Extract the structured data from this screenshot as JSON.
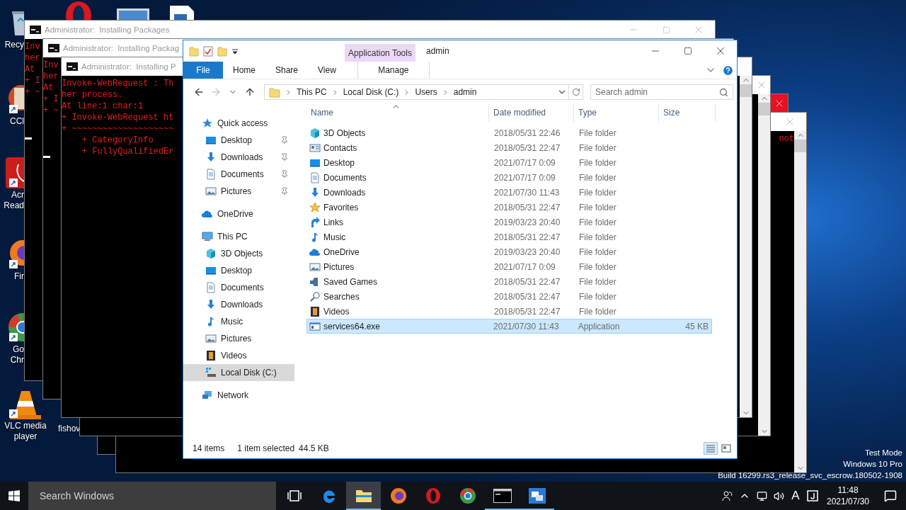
{
  "desktop": {
    "icons": [
      {
        "kind": "recycle",
        "lines": [
          "Recy"
        ],
        "shortcut": false
      },
      {
        "kind": "opera"
      },
      {
        "kind": "monitor"
      },
      {
        "kind": "document"
      },
      {
        "kind": "ccleaner",
        "lines": [
          "CCl"
        ],
        "shortcut": true
      },
      {
        "kind": "acrobat",
        "lines": [
          "Acr",
          "Read"
        ],
        "shortcut": true
      },
      {
        "kind": "firefox",
        "lines": [
          "Fir"
        ],
        "shortcut": true
      },
      {
        "kind": "chrome",
        "lines": [
          "Go",
          "Chr"
        ],
        "shortcut": true
      },
      {
        "kind": "vlc",
        "lines": [
          "VLC media",
          "player"
        ],
        "shortcut": true
      },
      {
        "kind": "file",
        "lines": [
          "fishov"
        ]
      }
    ],
    "system_text": [
      "Test Mode",
      "Windows 10 Pro",
      "Build 16299.rs3_release_svc_escrow.180502-1908"
    ]
  },
  "consoles": [
    {
      "title": "Administrator:  Installing Packages",
      "lines": [
        "Inv",
        "her",
        "At",
        "+ I",
        "+ ~"
      ],
      "cursor": true,
      "close_highlighted": false
    },
    {
      "title": "Administrator:  Installing Packag",
      "lines": [
        "Inv",
        "her",
        "At",
        "+ I",
        "+ ~"
      ],
      "cursor": true
    },
    {
      "title": "Administrator:  Installing P",
      "lines": [
        "Invoke-WebRequest : Th",
        "her process.",
        "At line:1 char:1",
        "+ Invoke-WebRequest ht",
        "+ ~~~~~~~~~~~~~~~~~~~~",
        "    + CategoryInfo",
        "    + FullyQualifiedEr"
      ],
      "cursor": false
    },
    {
      "close_highlighted": false
    },
    {
      "close_highlighted": true
    },
    {
      "lines": [
        "not"
      ],
      "close_highlighted": false
    }
  ],
  "explorer": {
    "title": "admin",
    "tool_group": "Application Tools",
    "ribbon_tabs": [
      {
        "label": "File",
        "kind": "file"
      },
      {
        "label": "Home",
        "kind": "tab"
      },
      {
        "label": "Share",
        "kind": "tab"
      },
      {
        "label": "View",
        "kind": "tab"
      },
      {
        "label": "Manage",
        "kind": "contextual"
      }
    ],
    "address": [
      "This PC",
      "Local Disk (C:)",
      "Users",
      "admin"
    ],
    "search": {
      "placeholder": "Search admin"
    },
    "nav": [
      {
        "label": "Quick access",
        "kind": "star",
        "selected": false,
        "children": [
          {
            "label": "Desktop",
            "kind": "desktop",
            "pinned": true,
            "selected": false
          },
          {
            "label": "Downloads",
            "kind": "downloads",
            "pinned": true,
            "selected": false
          },
          {
            "label": "Documents",
            "kind": "documents",
            "pinned": true,
            "selected": false
          },
          {
            "label": "Pictures",
            "kind": "pictures",
            "pinned": true,
            "selected": false
          }
        ]
      },
      {
        "label": "OneDrive",
        "kind": "onedrive",
        "selected": false
      },
      {
        "label": "This PC",
        "kind": "pc",
        "selected": false,
        "children": [
          {
            "label": "3D Objects",
            "kind": "cube",
            "pinned": false,
            "selected": false
          },
          {
            "label": "Desktop",
            "kind": "desktop",
            "pinned": false,
            "selected": false
          },
          {
            "label": "Documents",
            "kind": "documents",
            "pinned": false,
            "selected": false
          },
          {
            "label": "Downloads",
            "kind": "downloads",
            "pinned": false,
            "selected": false
          },
          {
            "label": "Music",
            "kind": "music",
            "pinned": false,
            "selected": false
          },
          {
            "label": "Pictures",
            "kind": "pictures",
            "pinned": false,
            "selected": false
          },
          {
            "label": "Videos",
            "kind": "videos",
            "pinned": false,
            "selected": false
          },
          {
            "label": "Local Disk (C:)",
            "kind": "disk",
            "pinned": false,
            "selected": true
          }
        ]
      },
      {
        "label": "Network",
        "kind": "network",
        "selected": false
      }
    ],
    "columns": [
      {
        "label": "Name",
        "sorted": true
      },
      {
        "label": "Date modified",
        "sorted": false
      },
      {
        "label": "Type",
        "sorted": false
      },
      {
        "label": "Size",
        "sorted": false
      }
    ],
    "rows": [
      {
        "name": "3D Objects",
        "kind": "cube",
        "date": "2018/05/31 22:46",
        "type": "File folder",
        "selected": false
      },
      {
        "name": "Contacts",
        "kind": "contacts",
        "date": "2018/05/31 22:47",
        "type": "File folder",
        "selected": false
      },
      {
        "name": "Desktop",
        "kind": "desktop",
        "date": "2021/07/17 0:09",
        "type": "File folder",
        "selected": false
      },
      {
        "name": "Documents",
        "kind": "documents",
        "date": "2021/07/17 0:09",
        "type": "File folder",
        "selected": false
      },
      {
        "name": "Downloads",
        "kind": "downloads",
        "date": "2021/07/30 11:43",
        "type": "File folder",
        "selected": false
      },
      {
        "name": "Favorites",
        "kind": "favorites",
        "date": "2018/05/31 22:47",
        "type": "File folder",
        "selected": false
      },
      {
        "name": "Links",
        "kind": "links",
        "date": "2019/03/23 20:40",
        "type": "File folder",
        "selected": false
      },
      {
        "name": "Music",
        "kind": "music",
        "date": "2018/05/31 22:47",
        "type": "File folder",
        "selected": false
      },
      {
        "name": "OneDrive",
        "kind": "onedrive",
        "date": "2019/03/23 20:40",
        "type": "File folder",
        "selected": false
      },
      {
        "name": "Pictures",
        "kind": "pictures",
        "date": "2021/07/17 0:09",
        "type": "File folder",
        "selected": false
      },
      {
        "name": "Saved Games",
        "kind": "savedgames",
        "date": "2018/05/31 22:47",
        "type": "File folder",
        "selected": false
      },
      {
        "name": "Searches",
        "kind": "searches",
        "date": "2018/05/31 22:47",
        "type": "File folder",
        "selected": false
      },
      {
        "name": "Videos",
        "kind": "videos",
        "date": "2018/05/31 22:47",
        "type": "File folder",
        "selected": false
      },
      {
        "name": "services64.exe",
        "kind": "exe",
        "date": "2021/07/30 11:43",
        "type": "Application",
        "size": "45 KB",
        "selected": true
      }
    ],
    "status": {
      "count": "14 items",
      "selection": "1 item selected",
      "size": "44.5 KB"
    },
    "views": [
      {
        "kind": "details",
        "selected": true
      },
      {
        "kind": "tiles",
        "selected": false
      }
    ]
  },
  "taskbar": {
    "search": {
      "placeholder": "Search Windows"
    },
    "apps": [
      {
        "kind": "taskview",
        "selected": false,
        "running": false
      },
      {
        "kind": "edge",
        "selected": false,
        "running": false
      },
      {
        "kind": "explorer",
        "selected": true,
        "running": true
      },
      {
        "kind": "firefox",
        "selected": false,
        "running": false
      },
      {
        "kind": "opera",
        "selected": false,
        "running": false
      },
      {
        "kind": "chrome",
        "selected": false,
        "running": false
      },
      {
        "kind": "console",
        "selected": false,
        "running": true
      },
      {
        "kind": "installer",
        "selected": false,
        "running": true
      }
    ],
    "ime": "A",
    "time": "11:48",
    "date": "2021/07/30"
  }
}
